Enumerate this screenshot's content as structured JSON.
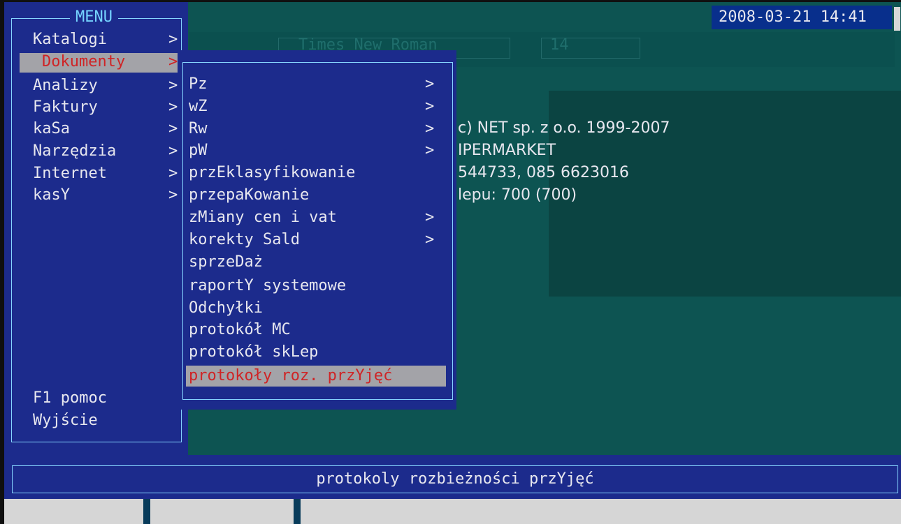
{
  "datetime": "2008-03-21 14:41",
  "menu": {
    "title": "MENU",
    "items": [
      {
        "label": "Katalogi",
        "arrow": ">"
      },
      {
        "label": "Dokumenty",
        "arrow": ">"
      },
      {
        "label": "Analizy",
        "arrow": ">"
      },
      {
        "label": "Faktury",
        "arrow": ">"
      },
      {
        "label": "kaSa",
        "arrow": ">"
      },
      {
        "label": "Narzędzia",
        "arrow": ">"
      },
      {
        "label": "Internet",
        "arrow": ">"
      },
      {
        "label": "kasY",
        "arrow": ">"
      }
    ],
    "footer": [
      {
        "label": "F1 pomoc"
      },
      {
        "label": "Wyjście"
      }
    ]
  },
  "submenu": {
    "items": [
      {
        "label": "Pz",
        "arrow": ">"
      },
      {
        "label": "wZ",
        "arrow": ">"
      },
      {
        "label": "Rw",
        "arrow": ">"
      },
      {
        "label": "pW",
        "arrow": ">"
      },
      {
        "label": "przEklasyfikowanie"
      },
      {
        "label": "przepaKowanie"
      },
      {
        "label": "zMiany cen i vat",
        "arrow": ">"
      },
      {
        "label": "korekty Sald",
        "arrow": ">"
      },
      {
        "label": "sprzeDaż"
      },
      {
        "label": "raportY systemowe"
      },
      {
        "label": "Odchyłki"
      },
      {
        "label": "protokół MC"
      },
      {
        "label": "protokół skLep"
      },
      {
        "label": "protokoły roz. przYjęć"
      }
    ]
  },
  "info": {
    "lines": [
      "c) NET sp. z o.o. 1999-2007",
      "IPERMARKET",
      "544733, 085 6623016",
      "lepu: 700 (700)"
    ]
  },
  "status": {
    "text": "protokoly rozbieżności przYjęć"
  },
  "background": {
    "font_box": "Times New Roman",
    "size_box": "14"
  }
}
